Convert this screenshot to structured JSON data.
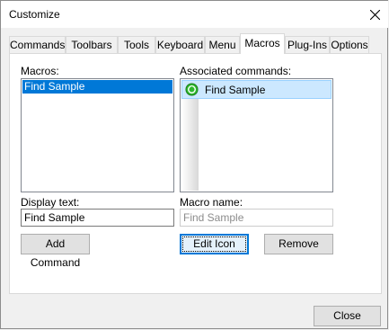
{
  "window": {
    "title": "Customize",
    "close_glyph": "✕"
  },
  "tabs": [
    {
      "label": "Commands"
    },
    {
      "label": "Toolbars"
    },
    {
      "label": "Tools"
    },
    {
      "label": "Keyboard"
    },
    {
      "label": "Menu"
    },
    {
      "label": "Macros",
      "active": true
    },
    {
      "label": "Plug-Ins"
    },
    {
      "label": "Options"
    }
  ],
  "macros": {
    "label": "Macros:",
    "items": [
      "Find Sample"
    ],
    "selected": "Find Sample"
  },
  "associated": {
    "label": "Associated commands:",
    "items": [
      {
        "label": "Find Sample",
        "icon": "green-circle-icon"
      }
    ]
  },
  "display_text": {
    "label": "Display text:",
    "value": "Find Sample"
  },
  "macro_name": {
    "label": "Macro name:",
    "value": "Find Sample"
  },
  "buttons": {
    "add_command": "Add Command",
    "edit_icon": "Edit Icon",
    "remove": "Remove",
    "close": "Close"
  },
  "colors": {
    "selection": "#0078d7",
    "assoc_highlight": "#cce8ff",
    "icon_green": "#2eb82e"
  }
}
